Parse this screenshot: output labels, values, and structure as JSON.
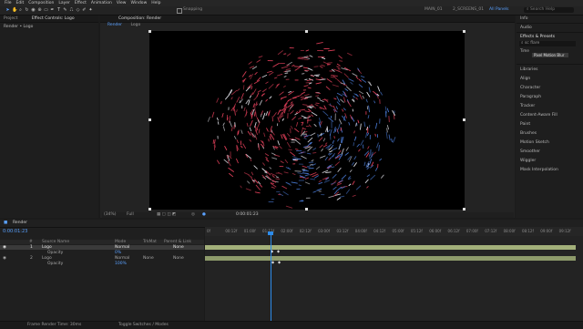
{
  "menu": [
    "File",
    "Edit",
    "Composition",
    "Layer",
    "Effect",
    "Animation",
    "View",
    "Window",
    "Help"
  ],
  "toolbar": {
    "snapping_label": "Snapping",
    "workspaces": [
      "MAIN_01",
      "2_SCREENS_01",
      "All Panels"
    ],
    "active_workspace_index": 2,
    "search_placeholder": "Search Help"
  },
  "left_panel": {
    "tabs": [
      "Project",
      "Effect Controls: Logo"
    ],
    "subtitle": "Render • Logo"
  },
  "comp_panel": {
    "tab": "Composition: Render",
    "breadcrumbs": [
      "Render",
      "Logo"
    ],
    "zoom": "(34%)",
    "resolution": "Full",
    "timecode": "0:00:01:23"
  },
  "right_panel": {
    "top_items": [
      "Info",
      "Audio"
    ],
    "effects_title": "Effects & Presets",
    "effects_search": "sc flare",
    "effect_group": "Time",
    "effect_item": "Pixel Motion Blur",
    "panels": [
      "Libraries",
      "Align",
      "Character",
      "Paragraph",
      "Tracker",
      "Content-Aware Fill",
      "Paint",
      "Brushes",
      "Motion Sketch",
      "Smoother",
      "Wiggler",
      "Mask Interpolation"
    ]
  },
  "timeline": {
    "tab": "Render",
    "timecode": "0:00:01:23",
    "columns": [
      "#",
      "Source Name",
      "Mode",
      "TrkMat",
      "Parent & Link"
    ],
    "layers": [
      {
        "num": "1",
        "name": "Logo",
        "mode": "Normal",
        "parent": "None",
        "selected": true
      },
      {
        "num": "",
        "name": "Opacity",
        "value": "0%",
        "selected": false
      },
      {
        "num": "2",
        "name": "Logo",
        "mode": "Normal",
        "trkmat": "None",
        "parent": "None",
        "selected": false
      },
      {
        "num": "",
        "name": "Opacity",
        "value": "100%",
        "selected": false
      }
    ],
    "ruler_ticks": [
      "0f",
      "00:12f",
      "01:00f",
      "01:12f",
      "02:00f",
      "02:12f",
      "03:00f",
      "03:12f",
      "04:00f",
      "04:12f",
      "05:00f",
      "05:12f",
      "06:00f",
      "06:12f",
      "07:00f",
      "07:12f",
      "08:00f",
      "08:12f",
      "09:00f",
      "09:12f"
    ],
    "status_left": "Frame Render Time: 30ms",
    "status_mid": "Toggle Switches / Modes"
  },
  "colors": {
    "accent": "#2d8ceb",
    "layer_bar": "#8d9a6a",
    "layer_bar_selected": "#a3b07a",
    "particle_red": "#e3405a",
    "particle_blue": "#4a7bd6"
  }
}
